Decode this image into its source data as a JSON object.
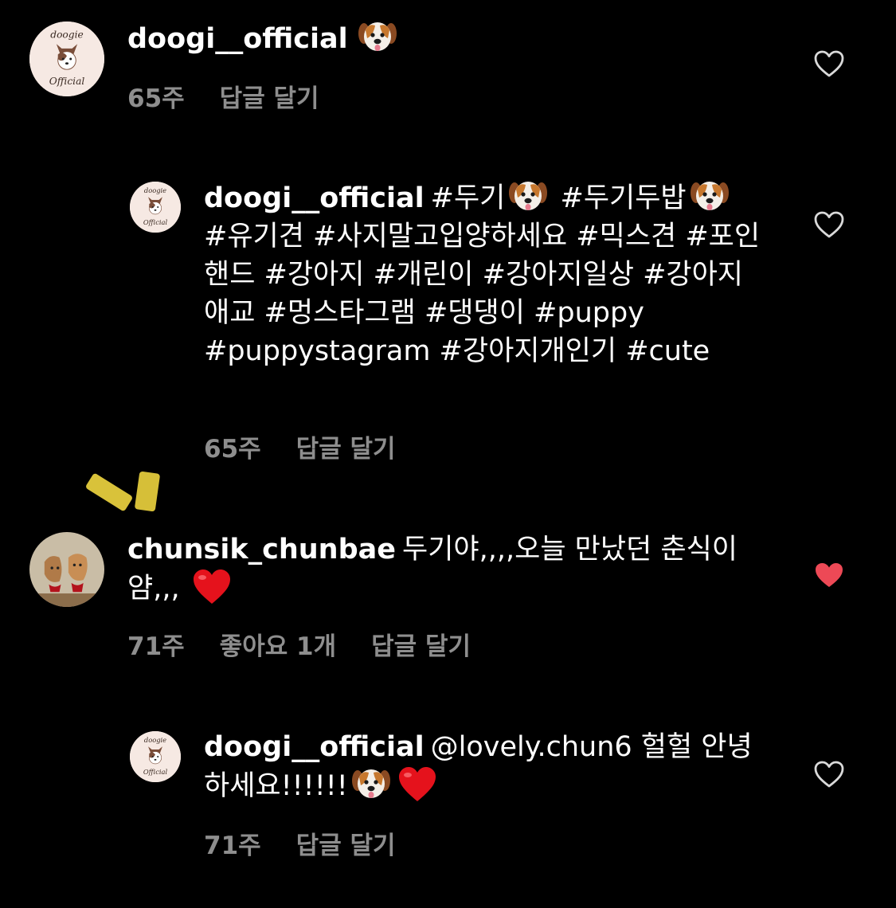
{
  "comments": [
    {
      "username": "doogi__official",
      "text": "",
      "time": "65주",
      "reply_label": "답글 달기"
    },
    {
      "username": "doogi__official",
      "text_parts": [
        "#두기",
        " #두기두밥",
        " #유기견 #사지말고입양하세요 #믹스견 #포인핸드 #강아지 #개린이 #강아지일상 #강아지애교 #멍스타그램 #댕댕이 #puppy #puppystagram #강아지개인기 #cute"
      ],
      "time": "65주",
      "reply_label": "답글 달기"
    },
    {
      "username": "chunsik_chunbae",
      "text": "두기야,,,,오늘 만났던 춘식이얌,,, ",
      "time": "71주",
      "likes": "좋아요 1개",
      "reply_label": "답글 달기",
      "liked": true
    },
    {
      "username": "doogi__official",
      "text": "@lovely.chun6 헐헐 안녕하세요!!!!!!",
      "time": "71주",
      "reply_label": "답글 달기"
    }
  ],
  "colors": {
    "background": "#000000",
    "meta": "#8e8e8e",
    "like_red": "#ed4956"
  },
  "icons": [
    "heart-outline-icon",
    "heart-filled-icon",
    "dog-face-emoji",
    "red-heart-emoji"
  ]
}
